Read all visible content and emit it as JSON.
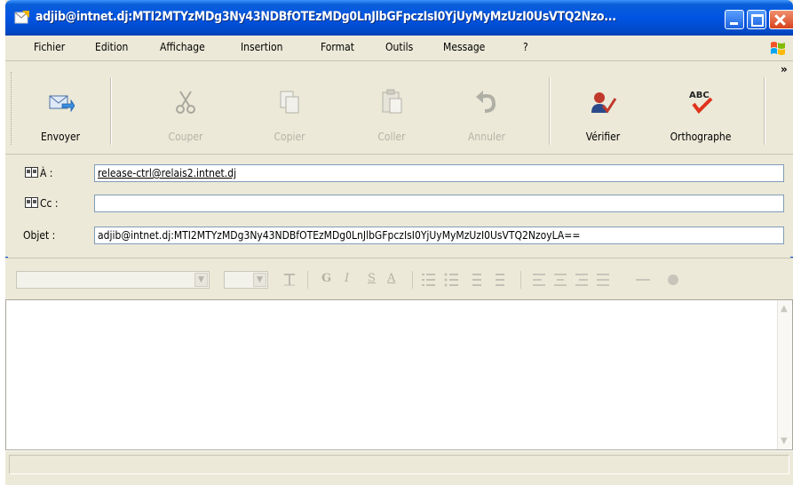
{
  "window": {
    "title": "adjib@intnet.dj:MTI2MTYzMDg3Ny43NDBfOTEzMDg0LnJlbGFpczIsI0YjUyMyMzUzI0UsVTQ2Nzo..."
  },
  "menu": [
    "Fichier",
    "Edition",
    "Affichage",
    "Insertion",
    "Format",
    "Outils",
    "Message",
    "?"
  ],
  "toolbar": {
    "send": "Envoyer",
    "cut": "Couper",
    "copy": "Copier",
    "paste": "Coller",
    "undo": "Annuler",
    "check": "Vérifier",
    "spelling": "Orthographe",
    "more": "»"
  },
  "fields": {
    "to_label": "À :",
    "to_value": "release-ctrl@relais2.intnet.dj",
    "cc_label": "Cc :",
    "cc_value": "",
    "subject_label": "Objet :",
    "subject_value": "adjib@intnet.dj:MTI2MTYzMDg3Ny43NDBfOTEzMDg0LnJlbGFpczIsI0YjUyMyMzUzI0UsVTQ2NzoyLA=="
  },
  "formatbar": {
    "bold": "G",
    "italic": "I",
    "underline": "S",
    "font_color": "A"
  },
  "body": {
    "text": ""
  },
  "colors": {
    "titlebar": "#0054e3",
    "chrome": "#ece9d8",
    "input_border": "#7f9db9"
  }
}
